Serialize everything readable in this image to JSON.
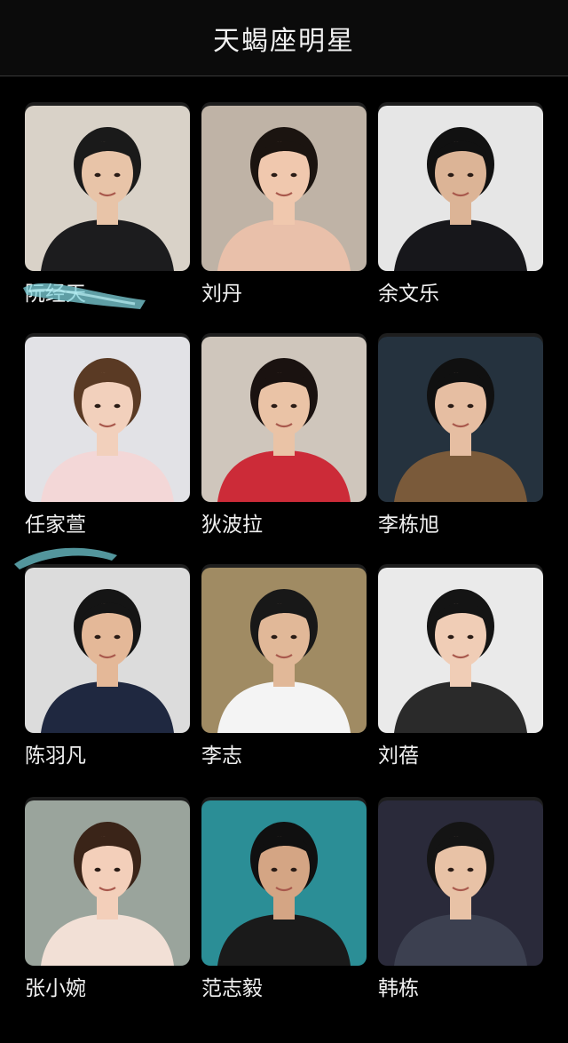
{
  "header": {
    "title": "天蝎座明星"
  },
  "celebrities": [
    {
      "name": "阮经天",
      "bg": "#d9d2c8",
      "accent": "#1c1c1e",
      "skin": "#e8c4a8",
      "hair": "#1a1a1a"
    },
    {
      "name": "刘丹",
      "bg": "#bfb3a6",
      "accent": "#e9c0aa",
      "skin": "#f0c8ae",
      "hair": "#1b1410"
    },
    {
      "name": "余文乐",
      "bg": "#e6e6e6",
      "accent": "#17171b",
      "skin": "#dcb496",
      "hair": "#111111"
    },
    {
      "name": "任家萱",
      "bg": "#e2e2e6",
      "accent": "#f3d7d7",
      "skin": "#f2d0bc",
      "hair": "#5a3a24"
    },
    {
      "name": "狄波拉",
      "bg": "#cfc6bc",
      "accent": "#cc2b38",
      "skin": "#eac3a6",
      "hair": "#1a1210"
    },
    {
      "name": "李栋旭",
      "bg": "#25323e",
      "accent": "#7a5a3a",
      "skin": "#e6bea2",
      "hair": "#101010"
    },
    {
      "name": "陈羽凡",
      "bg": "#dcdcdc",
      "accent": "#1f2840",
      "skin": "#e4b898",
      "hair": "#151515"
    },
    {
      "name": "李志",
      "bg": "#a08b63",
      "accent": "#f4f4f4",
      "skin": "#e1b898",
      "hair": "#181818"
    },
    {
      "name": "刘蓓",
      "bg": "#eaeaea",
      "accent": "#2a2a2a",
      "skin": "#f0cdb6",
      "hair": "#141414"
    },
    {
      "name": "张小婉",
      "bg": "#9aa49c",
      "accent": "#f2e0d6",
      "skin": "#f3cfba",
      "hair": "#3a2418"
    },
    {
      "name": "范志毅",
      "bg": "#2b8e96",
      "accent": "#1a1a1a",
      "skin": "#d4a584",
      "hair": "#101010"
    },
    {
      "name": "韩栋",
      "bg": "#2a2a3a",
      "accent": "#3c4050",
      "skin": "#e8c2a6",
      "hair": "#141414"
    }
  ]
}
